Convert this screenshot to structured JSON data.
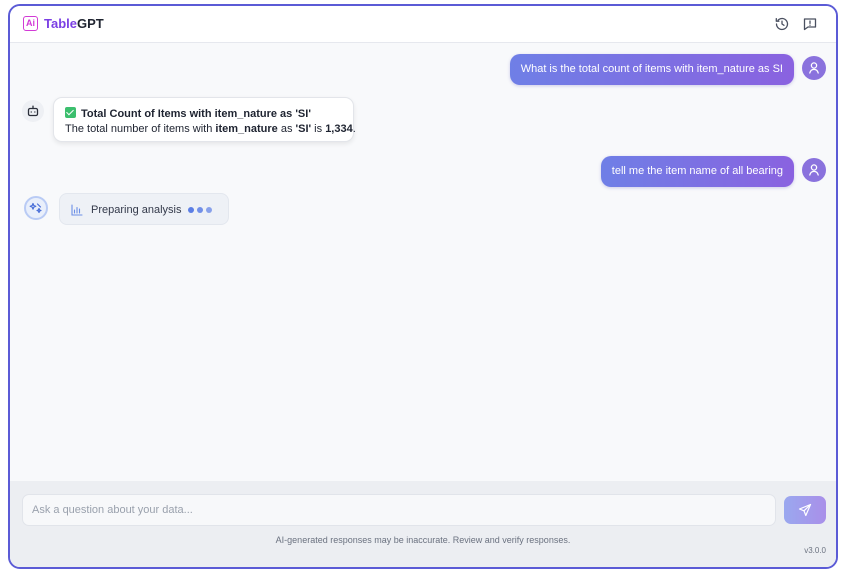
{
  "app": {
    "logo_icon": "ai-logo-icon",
    "logo_letters": "Ai",
    "brand_part1": "Table",
    "brand_part2": "GPT",
    "header_icons": [
      "history-icon",
      "feedback-icon"
    ]
  },
  "colors": {
    "frame_border": "#5b5bd6",
    "brand_purple": "#7b3fe4",
    "user_bubble_start": "#6f7fe6",
    "user_bubble_end": "#8a62e0",
    "success_green": "#3cbf6e",
    "loader_dots": "#5b7ee5"
  },
  "messages": [
    {
      "role": "user",
      "text": "What is the total count of items with item_nature as SI"
    },
    {
      "role": "assistant",
      "title_icon": "check-icon",
      "title": "Total Count of Items with item_nature as 'SI'",
      "body_prefix": "The total number of items with ",
      "body_field": "item_nature",
      "body_mid": " as ",
      "body_value": "'SI'",
      "body_mid2": " is ",
      "body_count": "1,334",
      "body_suffix": "."
    },
    {
      "role": "user",
      "text": "tell me the item name of all bearing"
    },
    {
      "role": "assistant-loading",
      "icon": "bar-chart-icon",
      "text": "Preparing analysis"
    }
  ],
  "composer": {
    "placeholder": "Ask a question about your data...",
    "value": "",
    "send_icon": "send-icon",
    "disclaimer": "AI-generated responses may be inaccurate. Review and verify responses.",
    "version": "v3.0.0"
  }
}
